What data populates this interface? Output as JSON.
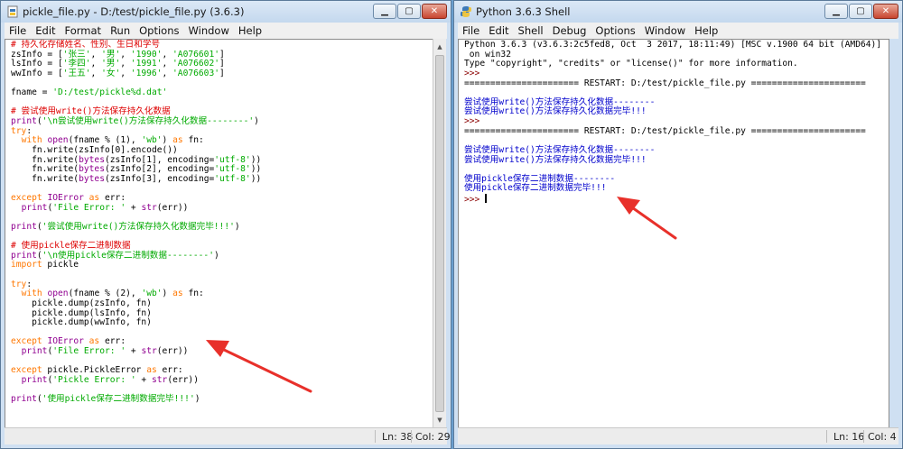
{
  "editor_window": {
    "title": "pickle_file.py - D:/test/pickle_file.py (3.6.3)",
    "menu": [
      "File",
      "Edit",
      "Format",
      "Run",
      "Options",
      "Window",
      "Help"
    ],
    "status": {
      "ln": "Ln: 38",
      "col": "Col: 29"
    }
  },
  "shell_window": {
    "title": "Python 3.6.3 Shell",
    "menu": [
      "File",
      "Edit",
      "Shell",
      "Debug",
      "Options",
      "Window",
      "Help"
    ],
    "status": {
      "ln": "Ln: 16",
      "col": "Col: 4"
    }
  },
  "window_controls": {
    "minimize": "▁",
    "maximize": "▢",
    "close": "✕"
  },
  "code_lines": [
    [
      [
        "c",
        "# 持久化存储姓名、性别、生日和学号"
      ]
    ],
    [
      [
        "",
        "zsInfo = ["
      ],
      [
        "s",
        "'张三'"
      ],
      [
        "",
        ", "
      ],
      [
        "s",
        "'男'"
      ],
      [
        "",
        ", "
      ],
      [
        "s",
        "'1990'"
      ],
      [
        "",
        ", "
      ],
      [
        "s",
        "'A076601'"
      ],
      [
        "",
        "]"
      ]
    ],
    [
      [
        "",
        "lsInfo = ["
      ],
      [
        "s",
        "'李四'"
      ],
      [
        "",
        ", "
      ],
      [
        "s",
        "'男'"
      ],
      [
        "",
        ", "
      ],
      [
        "s",
        "'1991'"
      ],
      [
        "",
        ", "
      ],
      [
        "s",
        "'A076602'"
      ],
      [
        "",
        "]"
      ]
    ],
    [
      [
        "",
        "wwInfo = ["
      ],
      [
        "s",
        "'王五'"
      ],
      [
        "",
        ", "
      ],
      [
        "s",
        "'女'"
      ],
      [
        "",
        ", "
      ],
      [
        "s",
        "'1996'"
      ],
      [
        "",
        ", "
      ],
      [
        "s",
        "'A076603'"
      ],
      [
        "",
        "]"
      ]
    ],
    [
      [
        "",
        ""
      ]
    ],
    [
      [
        "",
        "fname = "
      ],
      [
        "s",
        "'D:/test/pickle%d.dat'"
      ]
    ],
    [
      [
        "",
        ""
      ]
    ],
    [
      [
        "c",
        "# 尝试使用write()方法保存持久化数据"
      ]
    ],
    [
      [
        "b",
        "print"
      ],
      [
        "",
        "("
      ],
      [
        "s",
        "'\\n尝试使用write()方法保存持久化数据--------'"
      ],
      [
        "",
        ")"
      ]
    ],
    [
      [
        "k",
        "try"
      ],
      [
        "",
        ":"
      ]
    ],
    [
      [
        "",
        "  "
      ],
      [
        "k",
        "with"
      ],
      [
        "",
        " "
      ],
      [
        "b",
        "open"
      ],
      [
        "",
        "(fname % (1), "
      ],
      [
        "s",
        "'wb'"
      ],
      [
        "",
        ") "
      ],
      [
        "k",
        "as"
      ],
      [
        "",
        " fn:"
      ]
    ],
    [
      [
        "",
        "    fn.write(zsInfo[0].encode())"
      ]
    ],
    [
      [
        "",
        "    fn.write("
      ],
      [
        "b",
        "bytes"
      ],
      [
        "",
        "(zsInfo[1], encoding="
      ],
      [
        "s",
        "'utf-8'"
      ],
      [
        "",
        "))"
      ]
    ],
    [
      [
        "",
        "    fn.write("
      ],
      [
        "b",
        "bytes"
      ],
      [
        "",
        "(zsInfo[2], encoding="
      ],
      [
        "s",
        "'utf-8'"
      ],
      [
        "",
        "))"
      ]
    ],
    [
      [
        "",
        "    fn.write("
      ],
      [
        "b",
        "bytes"
      ],
      [
        "",
        "(zsInfo[3], encoding="
      ],
      [
        "s",
        "'utf-8'"
      ],
      [
        "",
        "))"
      ]
    ],
    [
      [
        "",
        ""
      ]
    ],
    [
      [
        "k",
        "except"
      ],
      [
        "",
        " "
      ],
      [
        "b",
        "IOError"
      ],
      [
        "",
        " "
      ],
      [
        "k",
        "as"
      ],
      [
        "",
        " err:"
      ]
    ],
    [
      [
        "",
        "  "
      ],
      [
        "b",
        "print"
      ],
      [
        "",
        "("
      ],
      [
        "s",
        "'File Error: '"
      ],
      [
        "",
        " + "
      ],
      [
        "b",
        "str"
      ],
      [
        "",
        "(err))"
      ]
    ],
    [
      [
        "",
        ""
      ]
    ],
    [
      [
        "b",
        "print"
      ],
      [
        "",
        "("
      ],
      [
        "s",
        "'尝试使用write()方法保存持久化数据完毕!!!'"
      ],
      [
        "",
        ")"
      ]
    ],
    [
      [
        "",
        ""
      ]
    ],
    [
      [
        "c",
        "# 使用pickle保存二进制数据"
      ]
    ],
    [
      [
        "b",
        "print"
      ],
      [
        "",
        "("
      ],
      [
        "s",
        "'\\n使用pickle保存二进制数据--------'"
      ],
      [
        "",
        ")"
      ]
    ],
    [
      [
        "k",
        "import"
      ],
      [
        "",
        " pickle"
      ]
    ],
    [
      [
        "",
        ""
      ]
    ],
    [
      [
        "k",
        "try"
      ],
      [
        "",
        ":"
      ]
    ],
    [
      [
        "",
        "  "
      ],
      [
        "k",
        "with"
      ],
      [
        "",
        " "
      ],
      [
        "b",
        "open"
      ],
      [
        "",
        "(fname % (2), "
      ],
      [
        "s",
        "'wb'"
      ],
      [
        "",
        ") "
      ],
      [
        "k",
        "as"
      ],
      [
        "",
        " fn:"
      ]
    ],
    [
      [
        "",
        "    pickle.dump(zsInfo, fn)"
      ]
    ],
    [
      [
        "",
        "    pickle.dump(lsInfo, fn)"
      ]
    ],
    [
      [
        "",
        "    pickle.dump(wwInfo, fn)"
      ]
    ],
    [
      [
        "",
        ""
      ]
    ],
    [
      [
        "k",
        "except"
      ],
      [
        "",
        " "
      ],
      [
        "b",
        "IOError"
      ],
      [
        "",
        " "
      ],
      [
        "k",
        "as"
      ],
      [
        "",
        " err:"
      ]
    ],
    [
      [
        "",
        "  "
      ],
      [
        "b",
        "print"
      ],
      [
        "",
        "("
      ],
      [
        "s",
        "'File Error: '"
      ],
      [
        "",
        " + "
      ],
      [
        "b",
        "str"
      ],
      [
        "",
        "(err))"
      ]
    ],
    [
      [
        "",
        ""
      ]
    ],
    [
      [
        "k",
        "except"
      ],
      [
        "",
        " pickle.PickleError "
      ],
      [
        "k",
        "as"
      ],
      [
        "",
        " err:"
      ]
    ],
    [
      [
        "",
        "  "
      ],
      [
        "b",
        "print"
      ],
      [
        "",
        "("
      ],
      [
        "s",
        "'Pickle Error: '"
      ],
      [
        "",
        " + "
      ],
      [
        "b",
        "str"
      ],
      [
        "",
        "(err))"
      ]
    ],
    [
      [
        "",
        ""
      ]
    ],
    [
      [
        "b",
        "print"
      ],
      [
        "",
        "("
      ],
      [
        "s",
        "'使用pickle保存二进制数据完毕!!!'"
      ],
      [
        "",
        ")"
      ]
    ]
  ],
  "shell_lines": [
    [
      [
        "",
        "Python 3.6.3 (v3.6.3:2c5fed8, Oct  3 2017, 18:11:49) [MSC v.1900 64 bit (AMD64)]"
      ]
    ],
    [
      [
        "",
        " on win32"
      ]
    ],
    [
      [
        "",
        "Type \"copyright\", \"credits\" or \"license()\" for more information."
      ]
    ],
    [
      [
        "prm",
        ">>> "
      ]
    ],
    [
      [
        "",
        "====================== RESTART: D:/test/pickle_file.py ======================"
      ]
    ],
    [
      [
        "",
        ""
      ]
    ],
    [
      [
        "out",
        "尝试使用write()方法保存持久化数据--------"
      ]
    ],
    [
      [
        "out",
        "尝试使用write()方法保存持久化数据完毕!!!"
      ]
    ],
    [
      [
        "prm",
        ">>> "
      ]
    ],
    [
      [
        "",
        "====================== RESTART: D:/test/pickle_file.py ======================"
      ]
    ],
    [
      [
        "",
        ""
      ]
    ],
    [
      [
        "out",
        "尝试使用write()方法保存持久化数据--------"
      ]
    ],
    [
      [
        "out",
        "尝试使用write()方法保存持久化数据完毕!!!"
      ]
    ],
    [
      [
        "",
        ""
      ]
    ],
    [
      [
        "out",
        "使用pickle保存二进制数据--------"
      ]
    ],
    [
      [
        "out",
        "使用pickle保存二进制数据完毕!!!"
      ]
    ],
    [
      [
        "prm",
        ">>> "
      ],
      [
        "cursor",
        ""
      ]
    ]
  ],
  "watermark": {
    "brand": "Bai",
    "suffix": "经验",
    "url": "jingyan.baidu.com"
  },
  "colors": {
    "keyword": "#ff7700",
    "string": "#00aa00",
    "comment": "#dd0000",
    "builtin": "#900090",
    "output": "#0000cc",
    "prompt": "#8b0000",
    "arrow": "#e8302a"
  }
}
